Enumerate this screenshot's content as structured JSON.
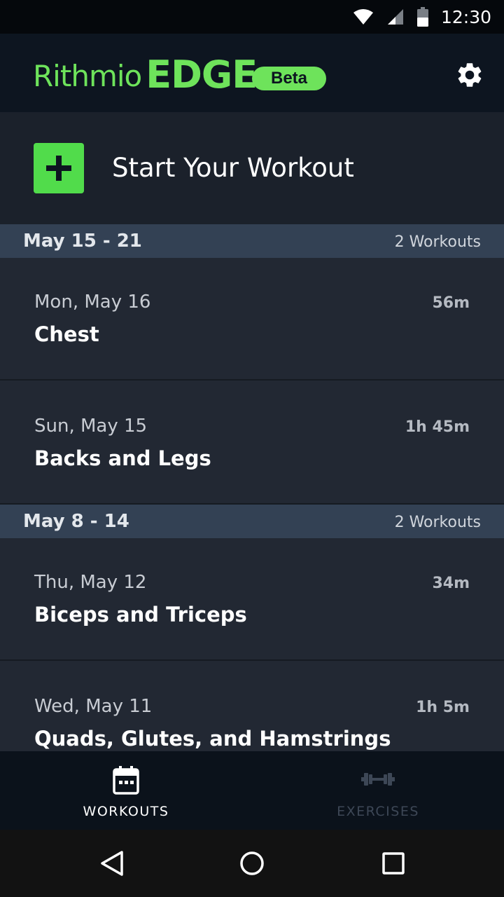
{
  "status_bar": {
    "time": "12:30",
    "icons": [
      "wifi-icon",
      "signal-icon",
      "battery-icon"
    ]
  },
  "app_bar": {
    "brand_name": "Rithmio",
    "brand_edge": "EDGE",
    "badge": "Beta",
    "settings_icon": "gear-icon"
  },
  "start_workout": {
    "label": "Start Your Workout",
    "icon": "plus-icon"
  },
  "weeks": [
    {
      "range": "May 15 - 21",
      "count": "2 Workouts",
      "workouts": [
        {
          "date": "Mon, May 16",
          "name": "Chest",
          "duration": "56m"
        },
        {
          "date": "Sun, May 15",
          "name": "Backs and Legs",
          "duration": "1h 45m"
        }
      ]
    },
    {
      "range": "May 8 - 14",
      "count": "2 Workouts",
      "workouts": [
        {
          "date": "Thu, May 12",
          "name": "Biceps and Triceps",
          "duration": "34m"
        },
        {
          "date": "Wed, May 11",
          "name": "Quads, Glutes, and Hamstrings",
          "duration": "1h 5m"
        }
      ]
    }
  ],
  "bottom_nav": {
    "tabs": [
      {
        "label": "WORKOUTS",
        "icon": "calendar-icon",
        "active": true
      },
      {
        "label": "EXERCISES",
        "icon": "dumbbell-icon",
        "active": false
      }
    ]
  },
  "system_nav": [
    "back-icon",
    "home-icon",
    "recents-icon"
  ],
  "colors": {
    "accent": "#6ee35b",
    "button_green": "#51dc4b",
    "header_bg": "#0d1520",
    "list_bg": "#222833",
    "week_header_bg": "#334154"
  }
}
